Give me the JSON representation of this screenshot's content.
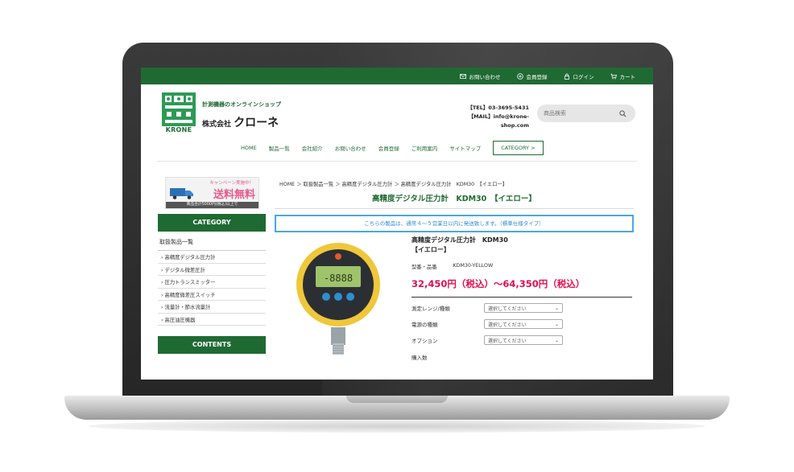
{
  "topbar": {
    "contact": "お問い合わせ",
    "register": "会員登録",
    "login": "ログイン",
    "cart": "カート"
  },
  "header": {
    "logo_text": "KRONE",
    "tagline": "計測機器のオンラインショップ",
    "company_prefix": "株式会社",
    "company_name": "クローネ",
    "tel": "【TEL】03-3695-5431",
    "mail": "【MAIL】info@krone-shop.com",
    "search_placeholder": "商品検索"
  },
  "nav": {
    "items": [
      "HOME",
      "製品一覧",
      "会社紹介",
      "お問い合わせ",
      "会員登録",
      "ご利用案内",
      "サイトマップ"
    ],
    "category_button": "CATEGORY >"
  },
  "sidebar": {
    "banner_top": "キャンペーン実施中！",
    "banner_main": "送料無料",
    "banner_sub": "商品合計5000円(税込)以上で",
    "category_head": "CATEGORY",
    "list_title": "取扱製品一覧",
    "items": [
      "高精度デジタル圧力計",
      "デジタル微差圧計",
      "圧力トランスミッター",
      "高精度微差圧スイッチ",
      "流量計・節水流量計",
      "高圧油圧機器"
    ],
    "contents_head": "CONTENTS"
  },
  "main": {
    "breadcrumb": "HOME ＞ 取扱製品一覧 ＞ 高精度デジタル圧力計 ＞ 高精度デジタル圧力計　KDM30　【イエロー】",
    "title": "高精度デジタル圧力計　KDM30　【イエロー】",
    "notice": "こちらの製品は、通常４～５営業日以内に発送致します。（標準仕様タイプ）",
    "product_name": "高精度デジタル圧力計　KDM30　【イエロー】",
    "model_label": "型番・品番",
    "model_value": "KDM30-YELLOW",
    "price": "32,450円（税込）～64,350円（税込）",
    "options": [
      {
        "label": "測定レンジ/種類",
        "value": "選択してください"
      },
      {
        "label": "電源の種類",
        "value": "選択してください"
      },
      {
        "label": "オプション",
        "value": "選択してください"
      }
    ],
    "qty_label": "購入数"
  },
  "colors": {
    "brand_green": "#1f6a33",
    "price_red": "#e0104e",
    "notice_blue": "#4aa8e0"
  }
}
